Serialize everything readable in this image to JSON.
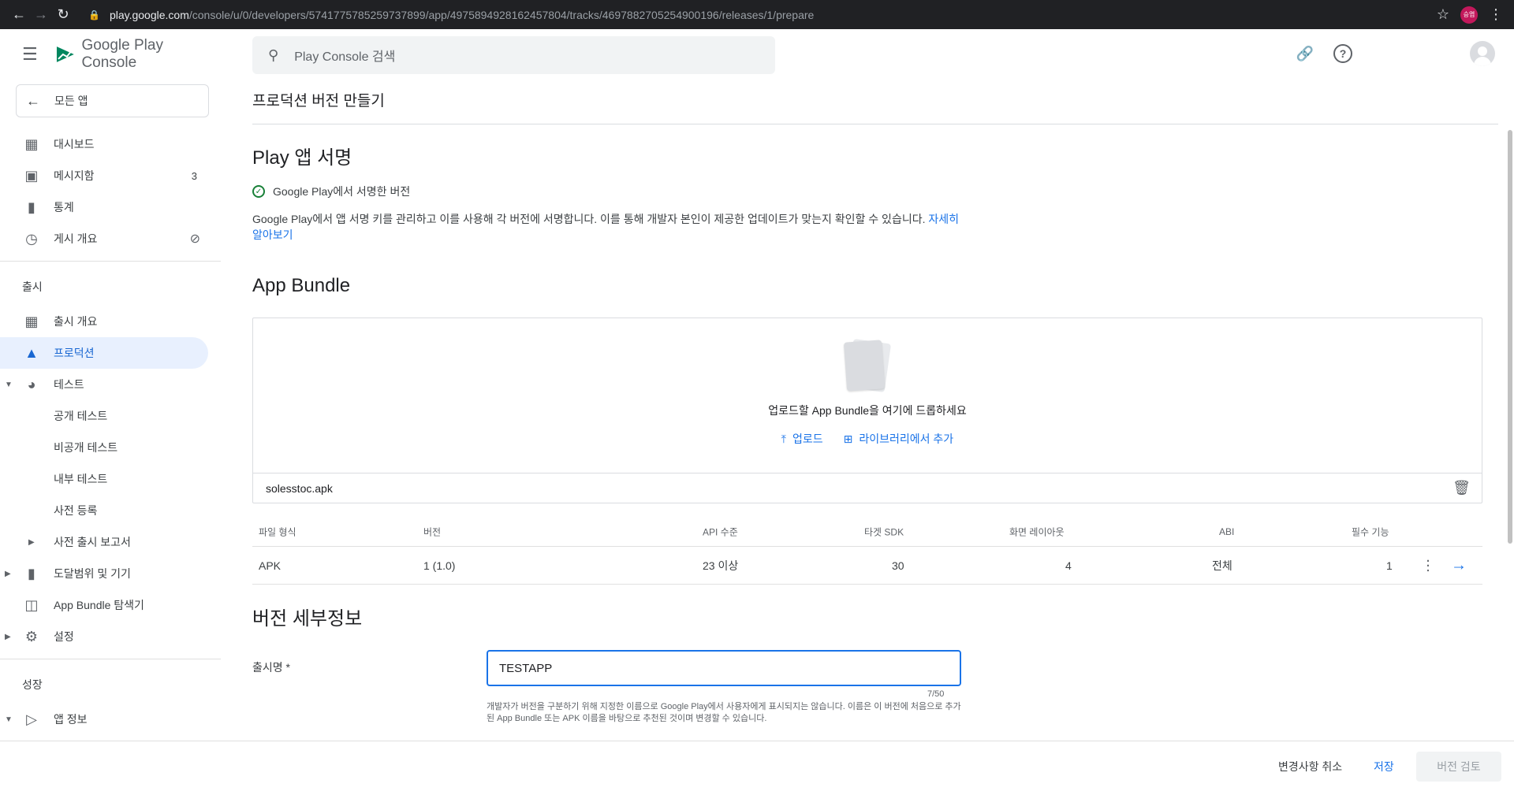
{
  "browser": {
    "url_host": "play.google.com",
    "url_path": "/console/u/0/developers/5741775785259737899/app/4975894928162457804/tracks/4697882705254900196/releases/1/prepare",
    "profile_initial": "승엽"
  },
  "sidebar": {
    "brand": "Google Play Console",
    "all_apps": "모든 앱",
    "top_items": [
      {
        "label": "대시보드",
        "icon": "dashboard-icon"
      },
      {
        "label": "메시지함",
        "icon": "inbox-icon",
        "badge": "3"
      },
      {
        "label": "통계",
        "icon": "stats-icon"
      },
      {
        "label": "게시 개요",
        "icon": "publish-overview-icon"
      }
    ],
    "release_section": "출시",
    "release_items": [
      {
        "label": "출시 개요"
      },
      {
        "label": "프로덕션"
      },
      {
        "label": "테스트"
      },
      {
        "label": "공개 테스트"
      },
      {
        "label": "비공개 테스트"
      },
      {
        "label": "내부 테스트"
      },
      {
        "label": "사전 등록"
      },
      {
        "label": "사전 출시 보고서"
      },
      {
        "label": "도달범위 및 기기"
      },
      {
        "label": "App Bundle 탐색기"
      },
      {
        "label": "설정"
      }
    ],
    "growth_section": "성장",
    "growth_items": [
      {
        "label": "앱 정보"
      }
    ]
  },
  "header": {
    "search_placeholder": "Play Console 검색"
  },
  "main": {
    "page_title": "프로덕션 버전 만들기",
    "signing": {
      "title": "Play 앱 서명",
      "status": "Google Play에서 서명한 버전",
      "description": "Google Play에서 앱 서명 키를 관리하고 이를 사용해 각 버전에 서명합니다. 이를 통해 개발자 본인이 제공한 업데이트가 맞는지 확인할 수 있습니다.",
      "learn_more": "자세히 알아보기"
    },
    "bundle": {
      "title": "App Bundle",
      "drop_text": "업로드할 App Bundle을 여기에 드롭하세요",
      "upload": "업로드",
      "add_from_library": "라이브러리에서 추가",
      "file_name": "solesstoc.apk"
    },
    "table": {
      "headers": [
        "파일 형식",
        "버전",
        "API 수준",
        "타겟 SDK",
        "화면 레이아웃",
        "ABI",
        "필수 기능"
      ],
      "row": [
        "APK",
        "1 (1.0)",
        "23 이상",
        "30",
        "4",
        "전체",
        "1"
      ]
    },
    "details": {
      "title": "버전 세부정보",
      "release_name_label": "출시명 *",
      "release_name_value": "TESTAPP",
      "counter": "7/50",
      "hint": "개발자가 버전을 구분하기 위해 지정한 이름으로 Google Play에서 사용자에게 표시되지는 않습니다. 이름은 이 버전에 처음으로 추가된 App Bundle 또는 APK 이름을 바탕으로 추천된 것이며 변경할 수 있습니다."
    }
  },
  "footer": {
    "discard": "변경사항 취소",
    "save": "저장",
    "review": "버전 검토"
  },
  "colors": {
    "accent": "#1a73e8",
    "active_bg": "#e8f0fe",
    "success": "#188038"
  }
}
